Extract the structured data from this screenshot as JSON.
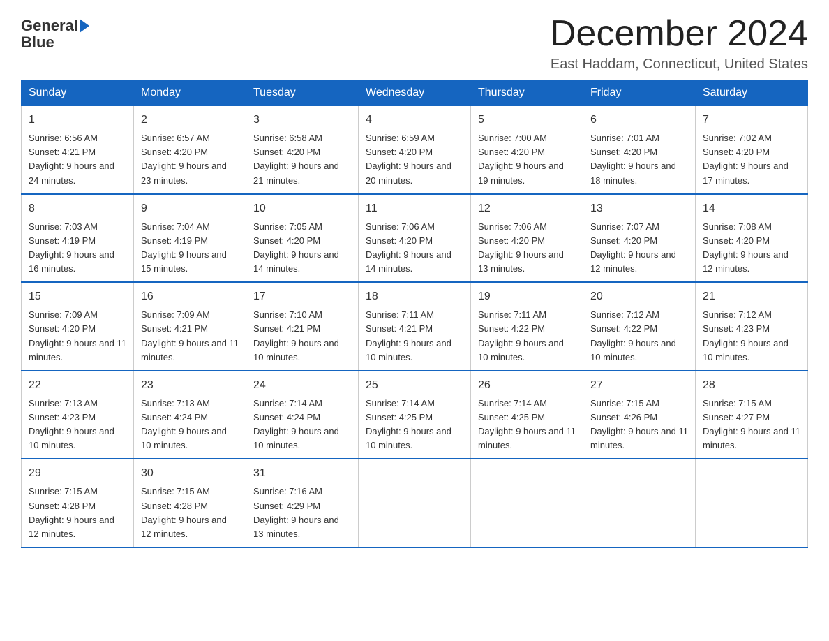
{
  "header": {
    "logo_line1": "General",
    "logo_line2": "Blue",
    "month_title": "December 2024",
    "location": "East Haddam, Connecticut, United States"
  },
  "days_of_week": [
    "Sunday",
    "Monday",
    "Tuesday",
    "Wednesday",
    "Thursday",
    "Friday",
    "Saturday"
  ],
  "weeks": [
    [
      {
        "day": "1",
        "sunrise": "6:56 AM",
        "sunset": "4:21 PM",
        "daylight": "9 hours and 24 minutes."
      },
      {
        "day": "2",
        "sunrise": "6:57 AM",
        "sunset": "4:20 PM",
        "daylight": "9 hours and 23 minutes."
      },
      {
        "day": "3",
        "sunrise": "6:58 AM",
        "sunset": "4:20 PM",
        "daylight": "9 hours and 21 minutes."
      },
      {
        "day": "4",
        "sunrise": "6:59 AM",
        "sunset": "4:20 PM",
        "daylight": "9 hours and 20 minutes."
      },
      {
        "day": "5",
        "sunrise": "7:00 AM",
        "sunset": "4:20 PM",
        "daylight": "9 hours and 19 minutes."
      },
      {
        "day": "6",
        "sunrise": "7:01 AM",
        "sunset": "4:20 PM",
        "daylight": "9 hours and 18 minutes."
      },
      {
        "day": "7",
        "sunrise": "7:02 AM",
        "sunset": "4:20 PM",
        "daylight": "9 hours and 17 minutes."
      }
    ],
    [
      {
        "day": "8",
        "sunrise": "7:03 AM",
        "sunset": "4:19 PM",
        "daylight": "9 hours and 16 minutes."
      },
      {
        "day": "9",
        "sunrise": "7:04 AM",
        "sunset": "4:19 PM",
        "daylight": "9 hours and 15 minutes."
      },
      {
        "day": "10",
        "sunrise": "7:05 AM",
        "sunset": "4:20 PM",
        "daylight": "9 hours and 14 minutes."
      },
      {
        "day": "11",
        "sunrise": "7:06 AM",
        "sunset": "4:20 PM",
        "daylight": "9 hours and 14 minutes."
      },
      {
        "day": "12",
        "sunrise": "7:06 AM",
        "sunset": "4:20 PM",
        "daylight": "9 hours and 13 minutes."
      },
      {
        "day": "13",
        "sunrise": "7:07 AM",
        "sunset": "4:20 PM",
        "daylight": "9 hours and 12 minutes."
      },
      {
        "day": "14",
        "sunrise": "7:08 AM",
        "sunset": "4:20 PM",
        "daylight": "9 hours and 12 minutes."
      }
    ],
    [
      {
        "day": "15",
        "sunrise": "7:09 AM",
        "sunset": "4:20 PM",
        "daylight": "9 hours and 11 minutes."
      },
      {
        "day": "16",
        "sunrise": "7:09 AM",
        "sunset": "4:21 PM",
        "daylight": "9 hours and 11 minutes."
      },
      {
        "day": "17",
        "sunrise": "7:10 AM",
        "sunset": "4:21 PM",
        "daylight": "9 hours and 10 minutes."
      },
      {
        "day": "18",
        "sunrise": "7:11 AM",
        "sunset": "4:21 PM",
        "daylight": "9 hours and 10 minutes."
      },
      {
        "day": "19",
        "sunrise": "7:11 AM",
        "sunset": "4:22 PM",
        "daylight": "9 hours and 10 minutes."
      },
      {
        "day": "20",
        "sunrise": "7:12 AM",
        "sunset": "4:22 PM",
        "daylight": "9 hours and 10 minutes."
      },
      {
        "day": "21",
        "sunrise": "7:12 AM",
        "sunset": "4:23 PM",
        "daylight": "9 hours and 10 minutes."
      }
    ],
    [
      {
        "day": "22",
        "sunrise": "7:13 AM",
        "sunset": "4:23 PM",
        "daylight": "9 hours and 10 minutes."
      },
      {
        "day": "23",
        "sunrise": "7:13 AM",
        "sunset": "4:24 PM",
        "daylight": "9 hours and 10 minutes."
      },
      {
        "day": "24",
        "sunrise": "7:14 AM",
        "sunset": "4:24 PM",
        "daylight": "9 hours and 10 minutes."
      },
      {
        "day": "25",
        "sunrise": "7:14 AM",
        "sunset": "4:25 PM",
        "daylight": "9 hours and 10 minutes."
      },
      {
        "day": "26",
        "sunrise": "7:14 AM",
        "sunset": "4:25 PM",
        "daylight": "9 hours and 11 minutes."
      },
      {
        "day": "27",
        "sunrise": "7:15 AM",
        "sunset": "4:26 PM",
        "daylight": "9 hours and 11 minutes."
      },
      {
        "day": "28",
        "sunrise": "7:15 AM",
        "sunset": "4:27 PM",
        "daylight": "9 hours and 11 minutes."
      }
    ],
    [
      {
        "day": "29",
        "sunrise": "7:15 AM",
        "sunset": "4:28 PM",
        "daylight": "9 hours and 12 minutes."
      },
      {
        "day": "30",
        "sunrise": "7:15 AM",
        "sunset": "4:28 PM",
        "daylight": "9 hours and 12 minutes."
      },
      {
        "day": "31",
        "sunrise": "7:16 AM",
        "sunset": "4:29 PM",
        "daylight": "9 hours and 13 minutes."
      },
      null,
      null,
      null,
      null
    ]
  ]
}
